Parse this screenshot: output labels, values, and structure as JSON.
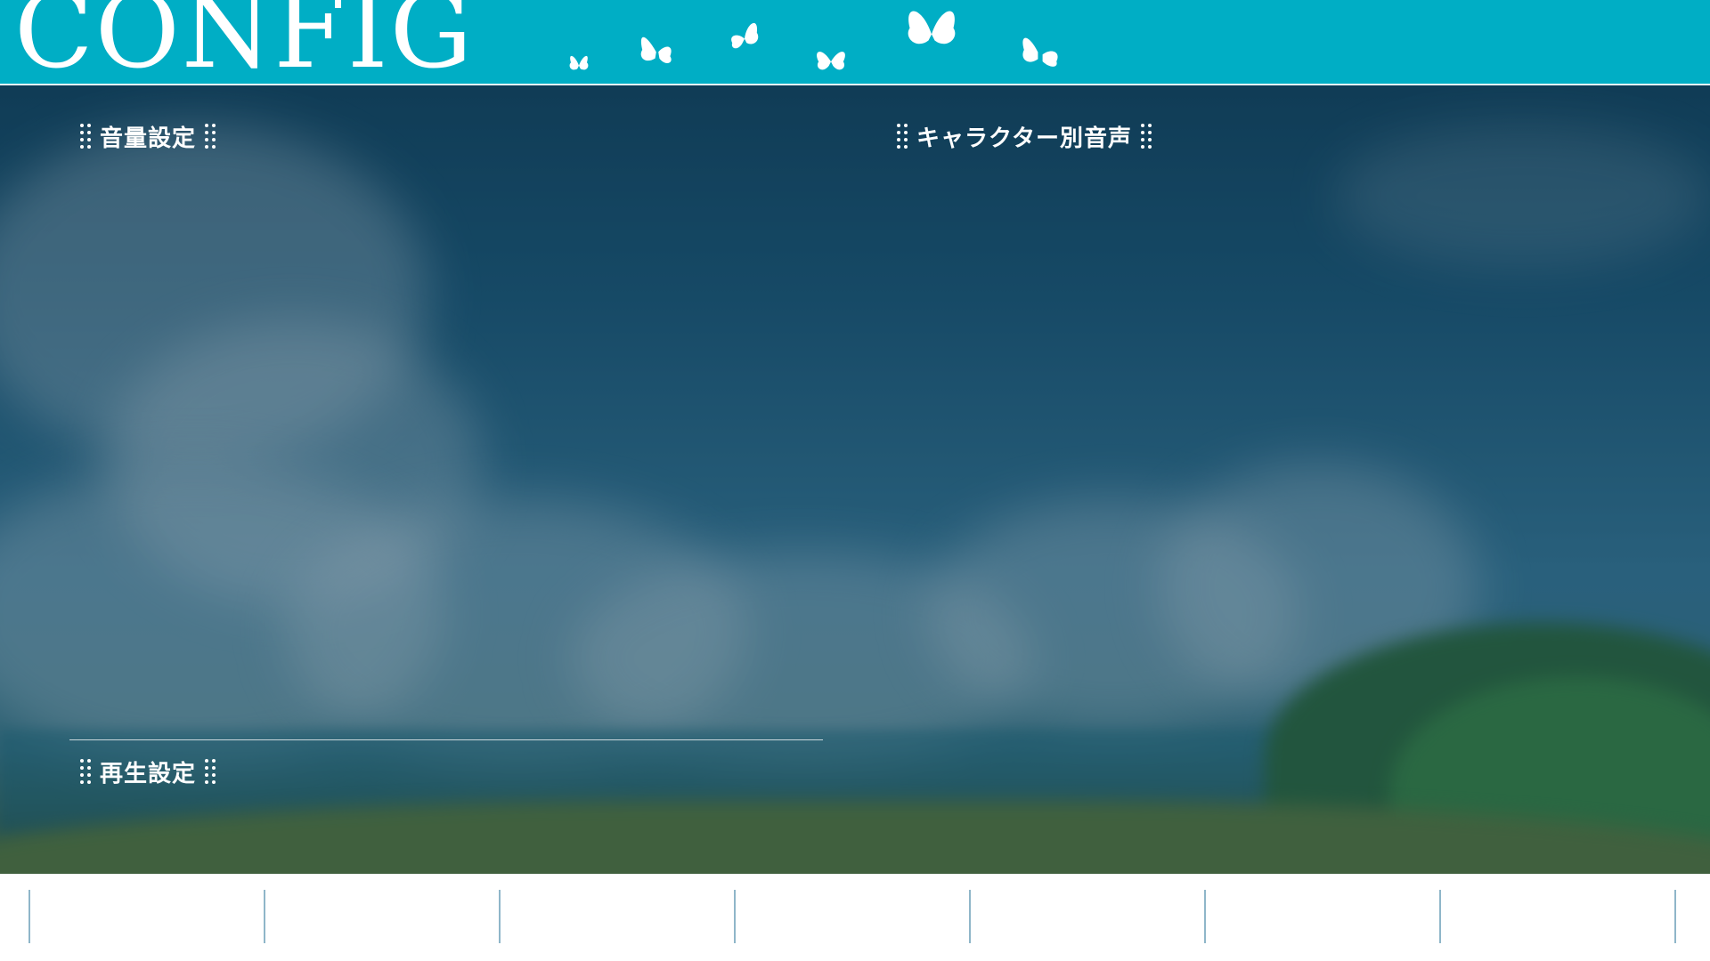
{
  "header": {
    "title": "CONFIG",
    "decoration_icon": "butterfly-icon",
    "accent_color": "#00aec5"
  },
  "sections": {
    "volume": {
      "label": "音量設定"
    },
    "character_voice": {
      "label": "キャラクター別音声"
    },
    "playback": {
      "label": "再生設定"
    }
  },
  "footer": {
    "tab_count": 8,
    "background": "#ffffff"
  }
}
